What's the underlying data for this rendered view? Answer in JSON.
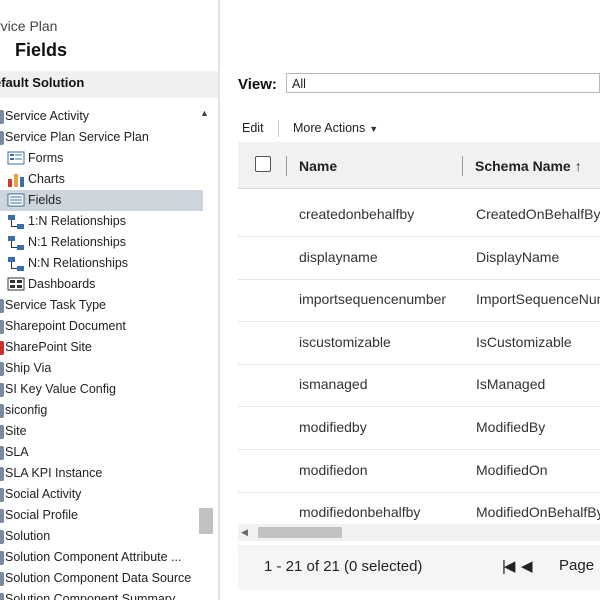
{
  "left_pane": {
    "entity_caption": "rvice Plan",
    "entity_title": "Fields",
    "solution_label": "efault Solution",
    "tree": [
      {
        "label": "Service Activity",
        "type": "entity"
      },
      {
        "label": "Service Plan Service Plan",
        "type": "entity"
      },
      {
        "label": "Forms",
        "type": "child",
        "icon": "forms-icon"
      },
      {
        "label": "Charts",
        "type": "child",
        "icon": "charts-icon"
      },
      {
        "label": "Fields",
        "type": "child",
        "icon": "fields-icon",
        "selected": true
      },
      {
        "label": "1:N Relationships",
        "type": "child",
        "icon": "relationship-icon"
      },
      {
        "label": "N:1 Relationships",
        "type": "child",
        "icon": "relationship-icon"
      },
      {
        "label": "N:N Relationships",
        "type": "child",
        "icon": "relationship-icon"
      },
      {
        "label": "Dashboards",
        "type": "child",
        "icon": "dashboards-icon"
      },
      {
        "label": "Service Task Type",
        "type": "entity"
      },
      {
        "label": "Sharepoint Document",
        "type": "entity"
      },
      {
        "label": "SharePoint Site",
        "type": "entity",
        "color": "red"
      },
      {
        "label": "Ship Via",
        "type": "entity"
      },
      {
        "label": "SI Key Value Config",
        "type": "entity"
      },
      {
        "label": "siconfig",
        "type": "entity"
      },
      {
        "label": "Site",
        "type": "entity"
      },
      {
        "label": "SLA",
        "type": "entity"
      },
      {
        "label": "SLA KPI Instance",
        "type": "entity"
      },
      {
        "label": "Social Activity",
        "type": "entity"
      },
      {
        "label": "Social Profile",
        "type": "entity"
      },
      {
        "label": "Solution",
        "type": "entity"
      },
      {
        "label": "Solution Component Attribute ...",
        "type": "entity"
      },
      {
        "label": "Solution Component Data Source",
        "type": "entity"
      },
      {
        "label": "Solution Component Summary",
        "type": "entity"
      }
    ]
  },
  "main": {
    "view_label": "View:",
    "view_value": "All",
    "toolbar": {
      "edit": "Edit",
      "more_actions": "More Actions",
      "more_caret": "▼"
    },
    "columns": {
      "name": "Name",
      "schema": "Schema Name",
      "sort_icon": "↑"
    },
    "rows": [
      {
        "name": "createdonbehalfby",
        "schema": "CreatedOnBehalfBy"
      },
      {
        "name": "displayname",
        "schema": "DisplayName"
      },
      {
        "name": "importsequencenumber",
        "schema": "ImportSequenceNumber"
      },
      {
        "name": "iscustomizable",
        "schema": "IsCustomizable"
      },
      {
        "name": "ismanaged",
        "schema": "IsManaged"
      },
      {
        "name": "modifiedby",
        "schema": "ModifiedBy"
      },
      {
        "name": "modifiedon",
        "schema": "ModifiedOn"
      },
      {
        "name": "modifiedonbehalfby",
        "schema": "ModifiedOnBehalfBy"
      }
    ],
    "footer": {
      "record_count": "1 - 21 of 21 (0 selected)",
      "first_page_glyph": "|◀",
      "prev_page_glyph": "◀",
      "page_label": "Page"
    }
  }
}
